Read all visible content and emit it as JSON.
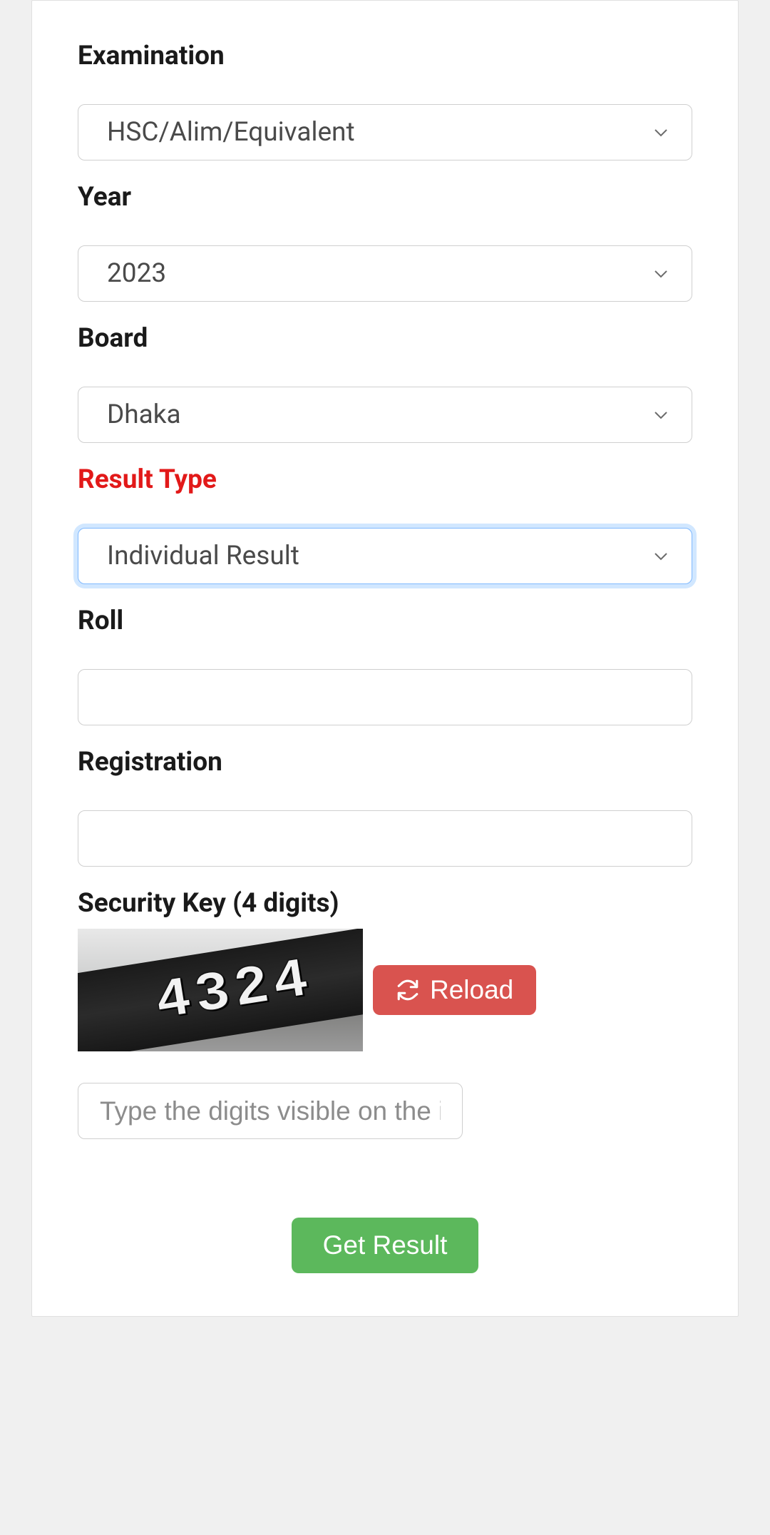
{
  "form": {
    "examination": {
      "label": "Examination",
      "value": "HSC/Alim/Equivalent"
    },
    "year": {
      "label": "Year",
      "value": "2023"
    },
    "board": {
      "label": "Board",
      "value": "Dhaka"
    },
    "result_type": {
      "label": "Result Type",
      "value": "Individual Result"
    },
    "roll": {
      "label": "Roll",
      "value": ""
    },
    "registration": {
      "label": "Registration",
      "value": ""
    },
    "security": {
      "label": "Security Key (4 digits)",
      "captcha_text": "4324",
      "reload_label": "Reload",
      "placeholder": "Type the digits visible on the image"
    },
    "submit_label": "Get Result"
  },
  "colors": {
    "accent_label": "#e21919",
    "reload_btn": "#d9534f",
    "submit_btn": "#5cb85c",
    "focus_ring": "#7fb9ff"
  }
}
